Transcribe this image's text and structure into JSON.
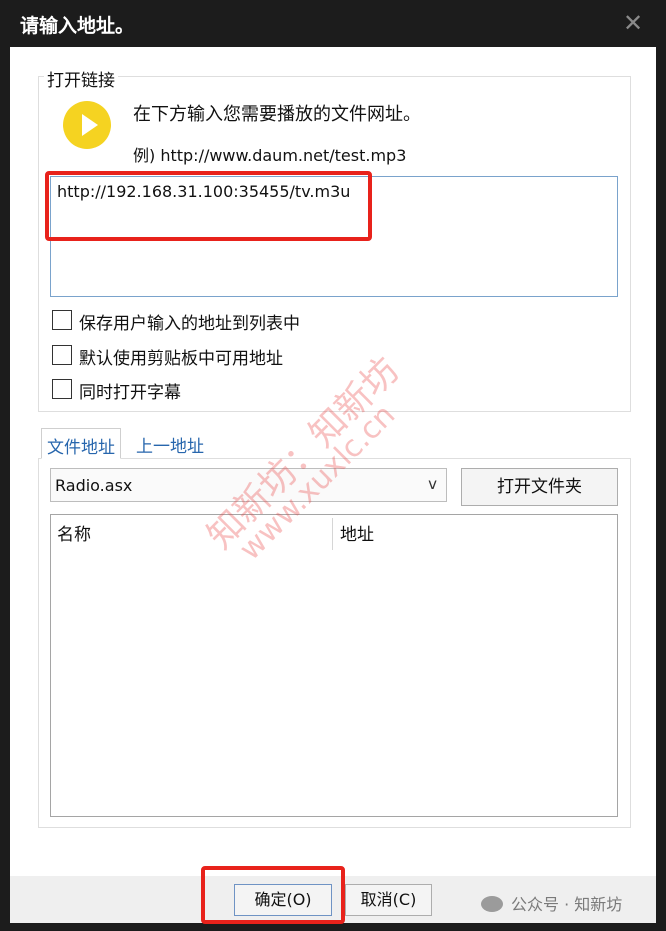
{
  "window": {
    "title": "请输入地址。",
    "close_glyph": "✕"
  },
  "link_group": {
    "legend": "打开链接",
    "icon": "play-icon",
    "instruction": "在下方输入您需要播放的文件网址。",
    "example": "例) http://www.daum.net/test.mp3",
    "url_value": "http://192.168.31.100:35455/tv.m3u",
    "checkboxes": [
      {
        "label": "保存用户输入的地址到列表中",
        "checked": false
      },
      {
        "label": "默认使用剪贴板中可用地址",
        "checked": false
      },
      {
        "label": "同时打开字幕",
        "checked": false
      }
    ]
  },
  "tabs": [
    {
      "label": "文件地址",
      "active": true
    },
    {
      "label": "上一地址",
      "active": false
    }
  ],
  "file_panel": {
    "dropdown_value": "Radio.asx",
    "dropdown_arrow": "v",
    "open_folder_button": "打开文件夹",
    "columns": [
      "名称",
      "地址"
    ]
  },
  "buttons": {
    "ok": "确定(O)",
    "cancel": "取消(C)"
  },
  "watermarks": {
    "line1": "知新坊：知新坊",
    "line2": "www.xuxlc.cn"
  },
  "footer": {
    "brand": "公众号 · 知新坊"
  },
  "colors": {
    "accent": "#2766ad",
    "highlight": "#e8221b",
    "play_icon": "#f5d321"
  }
}
